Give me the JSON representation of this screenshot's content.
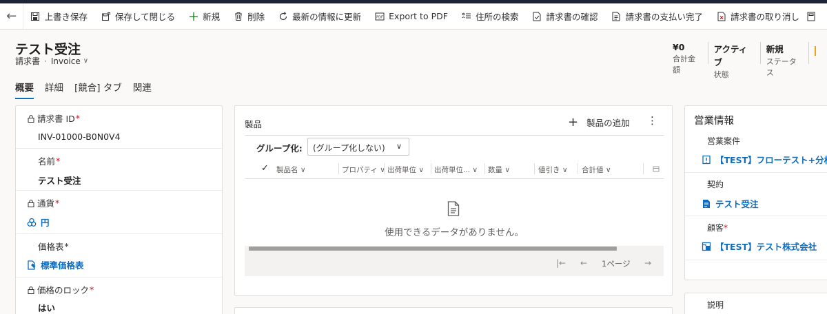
{
  "commandbar": {
    "items": [
      {
        "label": "上書き保存",
        "icon": "save-icon"
      },
      {
        "label": "保存して閉じる",
        "icon": "save-close-icon"
      },
      {
        "label": "新規",
        "icon": "plus-icon"
      },
      {
        "label": "削除",
        "icon": "trash-icon"
      },
      {
        "label": "最新の情報に更新",
        "icon": "refresh-icon"
      },
      {
        "label": "Export to PDF",
        "icon": "pdf-icon"
      },
      {
        "label": "住所の検索",
        "icon": "address-search-icon"
      },
      {
        "label": "請求書の確認",
        "icon": "invoice-confirm-icon"
      },
      {
        "label": "請求書の支払い完了",
        "icon": "invoice-paid-icon"
      },
      {
        "label": "請求書の取り消し",
        "icon": "invoice-cancel-icon"
      }
    ]
  },
  "header": {
    "title": "テスト受注",
    "entity": "請求書",
    "separator": "·",
    "form": "Invoice",
    "fields": [
      {
        "value": "¥0",
        "label": "合計金額"
      },
      {
        "value": "アクティブ",
        "label": "状態"
      },
      {
        "value": "新規",
        "label": "ステータス"
      }
    ]
  },
  "tabs": [
    "概要",
    "詳細",
    "[競合] タブ",
    "関連"
  ],
  "left_fields": [
    {
      "label": "請求書 ID",
      "required": "*",
      "value": "INV-01000-B0N0V4"
    },
    {
      "label": "名前",
      "required": "*",
      "value": "テスト受注"
    },
    {
      "label": "通貨",
      "required": "*",
      "value": "円"
    },
    {
      "label": "価格表",
      "required": "*",
      "value": "標準価格表"
    },
    {
      "label": "価格のロック",
      "required": "*",
      "value": "はい"
    }
  ],
  "products_grid": {
    "title": "製品",
    "add_label": "製品の追加",
    "more": "⋮",
    "group_label": "グループ化:",
    "group_value": "(グループ化しない)",
    "columns": [
      "製品名",
      "プロパティ",
      "出荷単位",
      "出荷単位...",
      "数量",
      "値引き",
      "合計値"
    ],
    "empty_message": "使用できるデータがありません。",
    "page_label": "1ページ"
  },
  "sales_info": {
    "title": "営業情報",
    "fields": [
      {
        "label": "営業案件",
        "required": "",
        "value": "【TEST】フローテスト+分析"
      },
      {
        "label": "契約",
        "required": "",
        "value": "テスト受注"
      },
      {
        "label": "顧客",
        "required": "*",
        "value": "【TEST】テスト株式会社"
      }
    ]
  },
  "description_card": {
    "label": "説明"
  },
  "colors": {
    "accent": "#0f6cbd",
    "required": "#c50f1f",
    "topbar": "#1e2536"
  }
}
